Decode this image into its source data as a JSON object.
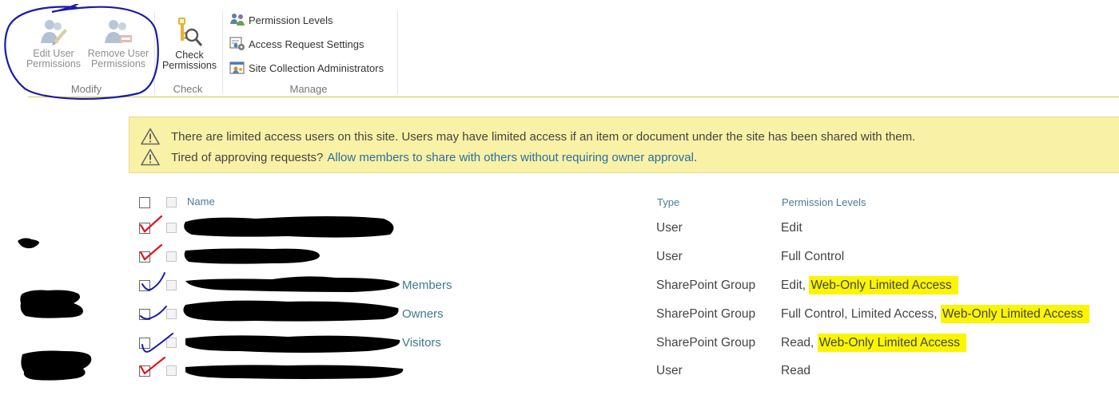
{
  "ribbon": {
    "groups": {
      "modify": {
        "label": "Modify",
        "buttons": [
          {
            "line1": "Edit User",
            "line2": "Permissions",
            "icon": "edit-user-permissions-icon",
            "enabled": false
          },
          {
            "line1": "Remove User",
            "line2": "Permissions",
            "icon": "remove-user-permissions-icon",
            "enabled": false
          }
        ]
      },
      "check": {
        "label": "Check",
        "buttons": [
          {
            "line1": "Check",
            "line2": "Permissions",
            "icon": "check-permissions-icon",
            "enabled": true
          }
        ]
      },
      "manage": {
        "label": "Manage",
        "buttons": [
          {
            "label": "Permission Levels",
            "icon": "permission-levels-icon"
          },
          {
            "label": "Access Request Settings",
            "icon": "access-request-settings-icon"
          },
          {
            "label": "Site Collection Administrators",
            "icon": "site-collection-administrators-icon"
          }
        ]
      }
    }
  },
  "banner": {
    "line1": "There are limited access users on this site. Users may have limited access if an item or document under the site has been shared with them.",
    "line2_text": "Tired of approving requests?",
    "line2_link": "Allow members to share with others without requiring owner approval",
    "line2_end": "."
  },
  "table": {
    "headers": {
      "name": "Name",
      "type": "Type",
      "permissions": "Permission Levels"
    },
    "rows": [
      {
        "name_suffix": "",
        "type": "User",
        "permissions_plain": "Edit",
        "permissions_highlight": ""
      },
      {
        "name_suffix": "",
        "type": "User",
        "permissions_plain": "Full Control",
        "permissions_highlight": ""
      },
      {
        "name_suffix": "Members",
        "type": "SharePoint Group",
        "permissions_plain": "Edit,",
        "permissions_highlight": "Web-Only Limited Access"
      },
      {
        "name_suffix": "Owners",
        "type": "SharePoint Group",
        "permissions_plain": "Full Control, Limited Access,",
        "permissions_highlight": "Web-Only Limited Access"
      },
      {
        "name_suffix": "Visitors",
        "type": "SharePoint Group",
        "permissions_plain": "Read,",
        "permissions_highlight": "Web-Only Limited Access"
      },
      {
        "name_suffix": "",
        "type": "User",
        "permissions_plain": "Read",
        "permissions_highlight": ""
      }
    ]
  },
  "colors": {
    "banner_bg": "#f9f1a5",
    "link": "#2a6ea5",
    "highlight": "#fbf500",
    "annotation_blue": "#1a1aa8",
    "annotation_red": "#e0141e",
    "redaction": "#000000"
  }
}
